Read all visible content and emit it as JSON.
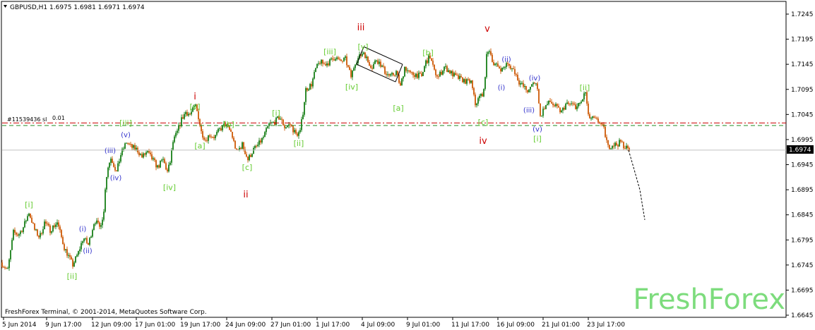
{
  "window": {
    "symbol_header": "GBPUSD,H1  1.6975 1.6981 1.6971 1.6974",
    "copyright": "FreshForex Terminal, © 2001-2014, MetaQuotes Software Corp.",
    "watermark": "FreshForex",
    "order_label": "#11539436 sl",
    "order_label_tail": "0.01",
    "current_price_label": "1.6974"
  },
  "colors": {
    "background": "#ffffff",
    "axis": "#000000",
    "bull_candle": "#2e8b2e",
    "bear_candle": "#d2691e",
    "wave_green": "#66cc33",
    "wave_red": "#cc0000",
    "wave_blue": "#3333cc",
    "sl_line": "#cc0000",
    "tp_line": "#228b22",
    "watermark": "#7ddc7d"
  },
  "chart_data": {
    "type": "candlestick",
    "symbol": "GBPUSD",
    "timeframe": "H1",
    "ohlc_header": {
      "open": 1.6975,
      "high": 1.6981,
      "low": 1.6971,
      "close": 1.6974
    },
    "ylim": [
      1.6645,
      1.7245
    ],
    "y_ticks": [
      "1.7245",
      "1.7195",
      "1.7145",
      "1.7095",
      "1.7045",
      "1.6995",
      "1.6945",
      "1.6895",
      "1.6845",
      "1.6795",
      "1.6745",
      "1.6695",
      "1.6645"
    ],
    "x_ticks": [
      "5 Jun 2014",
      "9 Jun 17:00",
      "12 Jun 09:00",
      "17 Jun 01:00",
      "19 Jun 17:00",
      "24 Jun 09:00",
      "27 Jun 01:00",
      "1 Jul 17:00",
      "4 Jul 09:00",
      "9 Jul 01:00",
      "11 Jul 17:00",
      "16 Jul 09:00",
      "21 Jul 01:00",
      "23 Jul 17:00"
    ],
    "current_price": 1.6974,
    "horizontal_levels": [
      {
        "kind": "stop-loss",
        "price": 1.7028
      },
      {
        "kind": "order",
        "price": 1.7023
      }
    ],
    "price_path": [
      [
        0,
        1.675
      ],
      [
        10,
        1.6735
      ],
      [
        18,
        1.681
      ],
      [
        25,
        1.6805
      ],
      [
        32,
        1.682
      ],
      [
        40,
        1.685
      ],
      [
        48,
        1.6815
      ],
      [
        55,
        1.68
      ],
      [
        62,
        1.683
      ],
      [
        70,
        1.6815
      ],
      [
        80,
        1.683
      ],
      [
        90,
        1.678
      ],
      [
        102,
        1.6745
      ],
      [
        110,
        1.677
      ],
      [
        117,
        1.68
      ],
      [
        124,
        1.6785
      ],
      [
        133,
        1.6835
      ],
      [
        140,
        1.682
      ],
      [
        146,
        1.685
      ],
      [
        148,
        1.69
      ],
      [
        151,
        1.6935
      ],
      [
        156,
        1.696
      ],
      [
        160,
        1.6945
      ],
      [
        164,
        1.693
      ],
      [
        170,
        1.6965
      ],
      [
        178,
        1.699
      ],
      [
        185,
        1.698
      ],
      [
        193,
        1.6975
      ],
      [
        200,
        1.696
      ],
      [
        207,
        1.697
      ],
      [
        215,
        1.6955
      ],
      [
        222,
        1.694
      ],
      [
        230,
        1.6955
      ],
      [
        236,
        1.693
      ],
      [
        240,
        1.695
      ],
      [
        244,
        1.699
      ],
      [
        250,
        1.701
      ],
      [
        256,
        1.7035
      ],
      [
        262,
        1.705
      ],
      [
        268,
        1.7045
      ],
      [
        276,
        1.7062
      ],
      [
        280,
        1.704
      ],
      [
        284,
        1.701
      ],
      [
        290,
        1.6995
      ],
      [
        296,
        1.7005
      ],
      [
        303,
        1.7
      ],
      [
        310,
        1.7015
      ],
      [
        318,
        1.7025
      ],
      [
        326,
        1.701
      ],
      [
        334,
        1.697
      ],
      [
        342,
        1.6985
      ],
      [
        350,
        1.6955
      ],
      [
        358,
        1.6975
      ],
      [
        365,
        1.6985
      ],
      [
        372,
        1.7
      ],
      [
        380,
        1.7025
      ],
      [
        388,
        1.703
      ],
      [
        395,
        1.704
      ],
      [
        402,
        1.702
      ],
      [
        410,
        1.7025
      ],
      [
        418,
        1.7005
      ],
      [
        424,
        1.701
      ],
      [
        428,
        1.705
      ],
      [
        432,
        1.7095
      ],
      [
        440,
        1.7105
      ],
      [
        446,
        1.7135
      ],
      [
        452,
        1.715
      ],
      [
        458,
        1.7145
      ],
      [
        466,
        1.715
      ],
      [
        474,
        1.716
      ],
      [
        480,
        1.715
      ],
      [
        488,
        1.7155
      ],
      [
        496,
        1.712
      ],
      [
        502,
        1.715
      ],
      [
        508,
        1.716
      ],
      [
        514,
        1.717
      ],
      [
        520,
        1.715
      ],
      [
        526,
        1.714
      ],
      [
        532,
        1.7155
      ],
      [
        538,
        1.7145
      ],
      [
        544,
        1.713
      ],
      [
        552,
        1.712
      ],
      [
        560,
        1.713
      ],
      [
        566,
        1.71
      ],
      [
        572,
        1.714
      ],
      [
        580,
        1.7125
      ],
      [
        588,
        1.7125
      ],
      [
        596,
        1.712
      ],
      [
        602,
        1.715
      ],
      [
        608,
        1.716
      ],
      [
        614,
        1.713
      ],
      [
        620,
        1.712
      ],
      [
        628,
        1.714
      ],
      [
        636,
        1.713
      ],
      [
        644,
        1.712
      ],
      [
        652,
        1.7115
      ],
      [
        660,
        1.711
      ],
      [
        666,
        1.711
      ],
      [
        672,
        1.7065
      ],
      [
        678,
        1.708
      ],
      [
        684,
        1.709
      ],
      [
        688,
        1.716
      ],
      [
        692,
        1.7175
      ],
      [
        698,
        1.7145
      ],
      [
        704,
        1.714
      ],
      [
        710,
        1.7135
      ],
      [
        716,
        1.7145
      ],
      [
        722,
        1.714
      ],
      [
        728,
        1.713
      ],
      [
        734,
        1.711
      ],
      [
        740,
        1.71
      ],
      [
        748,
        1.709
      ],
      [
        754,
        1.711
      ],
      [
        760,
        1.71
      ],
      [
        764,
        1.704
      ],
      [
        770,
        1.706
      ],
      [
        778,
        1.707
      ],
      [
        786,
        1.706
      ],
      [
        794,
        1.705
      ],
      [
        800,
        1.7065
      ],
      [
        808,
        1.7065
      ],
      [
        816,
        1.706
      ],
      [
        822,
        1.707
      ],
      [
        828,
        1.709
      ],
      [
        832,
        1.704
      ],
      [
        840,
        1.7035
      ],
      [
        848,
        1.703
      ],
      [
        854,
        1.7015
      ],
      [
        860,
        1.698
      ],
      [
        866,
        1.6985
      ],
      [
        872,
        1.6985
      ],
      [
        878,
        1.699
      ],
      [
        884,
        1.698
      ],
      [
        890,
        1.6974
      ]
    ],
    "projection": [
      [
        890,
        1.6974
      ],
      [
        898,
        1.6935
      ],
      [
        906,
        1.6895
      ],
      [
        913,
        1.6835
      ]
    ],
    "channel": {
      "upper": [
        [
          515,
          1.718
        ],
        [
          570,
          1.7145
        ]
      ],
      "lower": [
        [
          505,
          1.7145
        ],
        [
          560,
          1.711
        ]
      ],
      "ends": [
        [
          [
            515,
            1.718
          ],
          [
            505,
            1.7145
          ]
        ],
        [
          [
            570,
            1.7145
          ],
          [
            560,
            1.711
          ]
        ]
      ]
    },
    "wave_labels": [
      {
        "text": "[i]",
        "color": "green",
        "x": 41,
        "y": 1.686,
        "pos": "above"
      },
      {
        "text": "[ii]",
        "color": "green",
        "x": 102,
        "y": 1.6733,
        "pos": "below"
      },
      {
        "text": "(i)",
        "color": "blue",
        "x": 117,
        "y": 1.6812,
        "pos": "above"
      },
      {
        "text": "(ii)",
        "color": "blue",
        "x": 124,
        "y": 1.6783,
        "pos": "below"
      },
      {
        "text": "(iii)",
        "color": "blue",
        "x": 156,
        "y": 1.6968,
        "pos": "above"
      },
      {
        "text": "(iv)",
        "color": "blue",
        "x": 164,
        "y": 1.6928,
        "pos": "below"
      },
      {
        "text": "[iii]",
        "color": "green",
        "x": 178,
        "y": 1.7023,
        "pos": "above"
      },
      {
        "text": "(v)",
        "color": "blue",
        "x": 178,
        "y": 1.7,
        "pos": "above"
      },
      {
        "text": "[iv]",
        "color": "green",
        "x": 240,
        "y": 1.691,
        "pos": "below"
      },
      {
        "text": "i",
        "color": "red",
        "x": 276,
        "y": 1.7075,
        "pos": "above"
      },
      {
        "text": "[v]",
        "color": "green",
        "x": 276,
        "y": 1.7055,
        "pos": "above"
      },
      {
        "text": "[a]",
        "color": "green",
        "x": 283,
        "y": 1.6993,
        "pos": "below"
      },
      {
        "text": "[b]",
        "color": "green",
        "x": 324,
        "y": 1.702,
        "pos": "above"
      },
      {
        "text": "[c]",
        "color": "green",
        "x": 350,
        "y": 1.695,
        "pos": "below"
      },
      {
        "text": "ii",
        "color": "red",
        "x": 348,
        "y": 1.6898,
        "pos": "below"
      },
      {
        "text": "[i]",
        "color": "green",
        "x": 391,
        "y": 1.7043,
        "pos": "above"
      },
      {
        "text": "[ii]",
        "color": "green",
        "x": 423,
        "y": 1.6998,
        "pos": "below"
      },
      {
        "text": "[iii]",
        "color": "green",
        "x": 467,
        "y": 1.7165,
        "pos": "above"
      },
      {
        "text": "iii",
        "color": "red",
        "x": 511,
        "y": 1.7213,
        "pos": "above"
      },
      {
        "text": "[v]",
        "color": "green",
        "x": 514,
        "y": 1.7175,
        "pos": "above"
      },
      {
        "text": "[iv]",
        "color": "green",
        "x": 498,
        "y": 1.711,
        "pos": "below"
      },
      {
        "text": "[a]",
        "color": "green",
        "x": 564,
        "y": 1.7068,
        "pos": "below"
      },
      {
        "text": "[b]",
        "color": "green",
        "x": 606,
        "y": 1.7163,
        "pos": "above"
      },
      {
        "text": "v",
        "color": "red",
        "x": 690,
        "y": 1.721,
        "pos": "above"
      },
      {
        "text": "(ii)",
        "color": "blue",
        "x": 717,
        "y": 1.715,
        "pos": "above"
      },
      {
        "text": "(i)",
        "color": "blue",
        "x": 710,
        "y": 1.7108,
        "pos": "below"
      },
      {
        "text": "[c]",
        "color": "green",
        "x": 684,
        "y": 1.704,
        "pos": "below"
      },
      {
        "text": "iv",
        "color": "red",
        "x": 684,
        "y": 1.7005,
        "pos": "below"
      },
      {
        "text": "(iv)",
        "color": "blue",
        "x": 757,
        "y": 1.7113,
        "pos": "above"
      },
      {
        "text": "(iii)",
        "color": "blue",
        "x": 749,
        "y": 1.7063,
        "pos": "below"
      },
      {
        "text": "(v)",
        "color": "blue",
        "x": 761,
        "y": 1.7025,
        "pos": "below"
      },
      {
        "text": "[i]",
        "color": "green",
        "x": 761,
        "y": 1.7007,
        "pos": "below"
      },
      {
        "text": "[ii]",
        "color": "green",
        "x": 828,
        "y": 1.7093,
        "pos": "above"
      }
    ]
  }
}
